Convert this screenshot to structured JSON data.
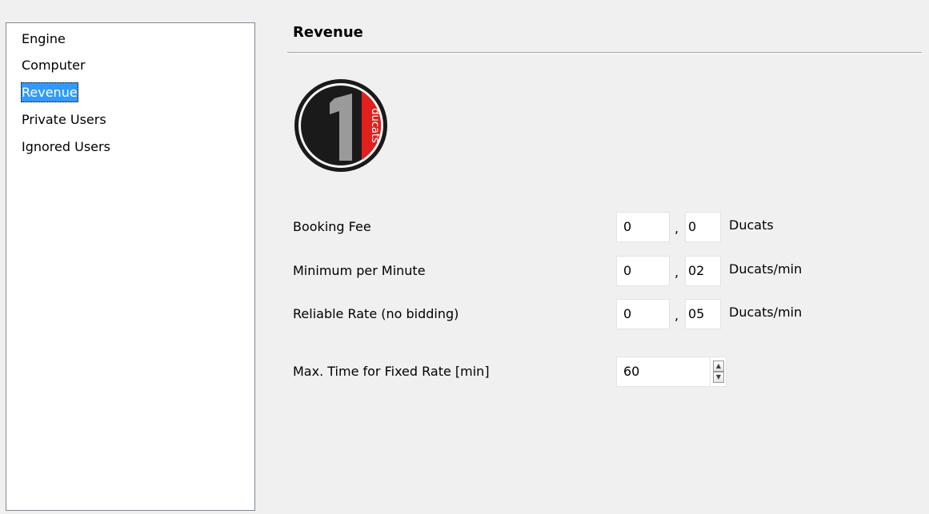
{
  "sidebar": {
    "items": [
      {
        "label": "Engine"
      },
      {
        "label": "Computer"
      },
      {
        "label": "Revenue",
        "selected": true
      },
      {
        "label": "Private Users"
      },
      {
        "label": "Ignored Users"
      }
    ]
  },
  "section": {
    "title": "Revenue"
  },
  "logo": {
    "numeral": "1",
    "text": "ducats",
    "icon": "ducats-coin-logo",
    "colors": {
      "ring": "#1a1a1a",
      "numeral": "#9a9a9a",
      "band": "#e0201c"
    }
  },
  "fields": {
    "booking_fee": {
      "label": "Booking Fee",
      "integer": "0",
      "decimal": "0",
      "unit": "Ducats"
    },
    "minimum_per_minute": {
      "label": "Minimum per Minute",
      "integer": "0",
      "decimal": "02",
      "unit": "Ducats/min"
    },
    "reliable_rate": {
      "label": "Reliable Rate (no bidding)",
      "integer": "0",
      "decimal": "05",
      "unit": "Ducats/min"
    },
    "max_time": {
      "label": "Max. Time for Fixed Rate [min]",
      "value": "60"
    }
  },
  "separator": ",",
  "spinner": {
    "up_icon": "spin-up-icon",
    "down_icon": "spin-down-icon"
  }
}
